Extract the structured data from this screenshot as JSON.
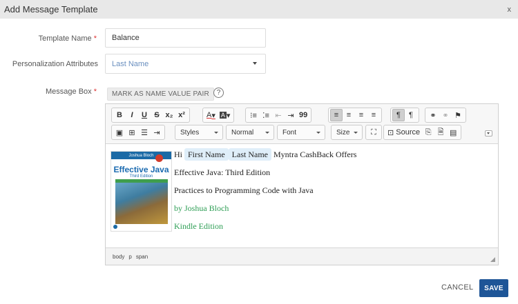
{
  "dialog": {
    "title": "Add Message Template",
    "close_label": "x"
  },
  "form": {
    "template_name": {
      "label": "Template Name",
      "required_mark": "*",
      "value": "Balance"
    },
    "personalization": {
      "label": "Personalization Attributes",
      "selected": "Last Name"
    },
    "message_box": {
      "label": "Message Box",
      "required_mark": "*",
      "mark_button": "MARK AS NAME VALUE PAIR",
      "help": "?"
    }
  },
  "toolbar": {
    "row1": {
      "bold": "B",
      "italic": "I",
      "underline": "U",
      "strike": "S",
      "subscript": "x₂",
      "superscript": "x²",
      "text_color": "A",
      "bg_color": "A",
      "numbered": "⁝≡",
      "bulleted": "⁚≡",
      "outdent": "⇤",
      "indent": "⇥",
      "blockquote": "99",
      "align_left": "≡",
      "align_center": "≡",
      "align_right": "≡",
      "justify": "≡",
      "ltr": "¶",
      "rtl": "¶",
      "link": "⚭",
      "unlink": "⚭",
      "anchor": "⚑"
    },
    "row2": {
      "styles": "Styles",
      "format": "Normal",
      "font": "Font",
      "size": "Size",
      "source": "Source"
    }
  },
  "content": {
    "book": {
      "author": "Joshua Bloch",
      "title": "Effective Java",
      "edition": "Third Edition"
    },
    "line1": {
      "greeting": "Hi",
      "chip1": "First Name",
      "chip2": "Last Name",
      "rest": "Myntra CashBack Offers"
    },
    "line2": "Effective Java: Third Edition",
    "line3": "Practices to Programming Code with Java",
    "line4": "by Joshua Bloch",
    "line5": "Kindle Edition",
    "colors": {
      "green": "#2e9e55",
      "chip_bg": "#dfeef9"
    }
  },
  "statusbar": {
    "path": [
      "body",
      "p",
      "span"
    ]
  },
  "actions": {
    "cancel": "CANCEL",
    "save": "SAVE",
    "save_color": "#1e5597"
  }
}
